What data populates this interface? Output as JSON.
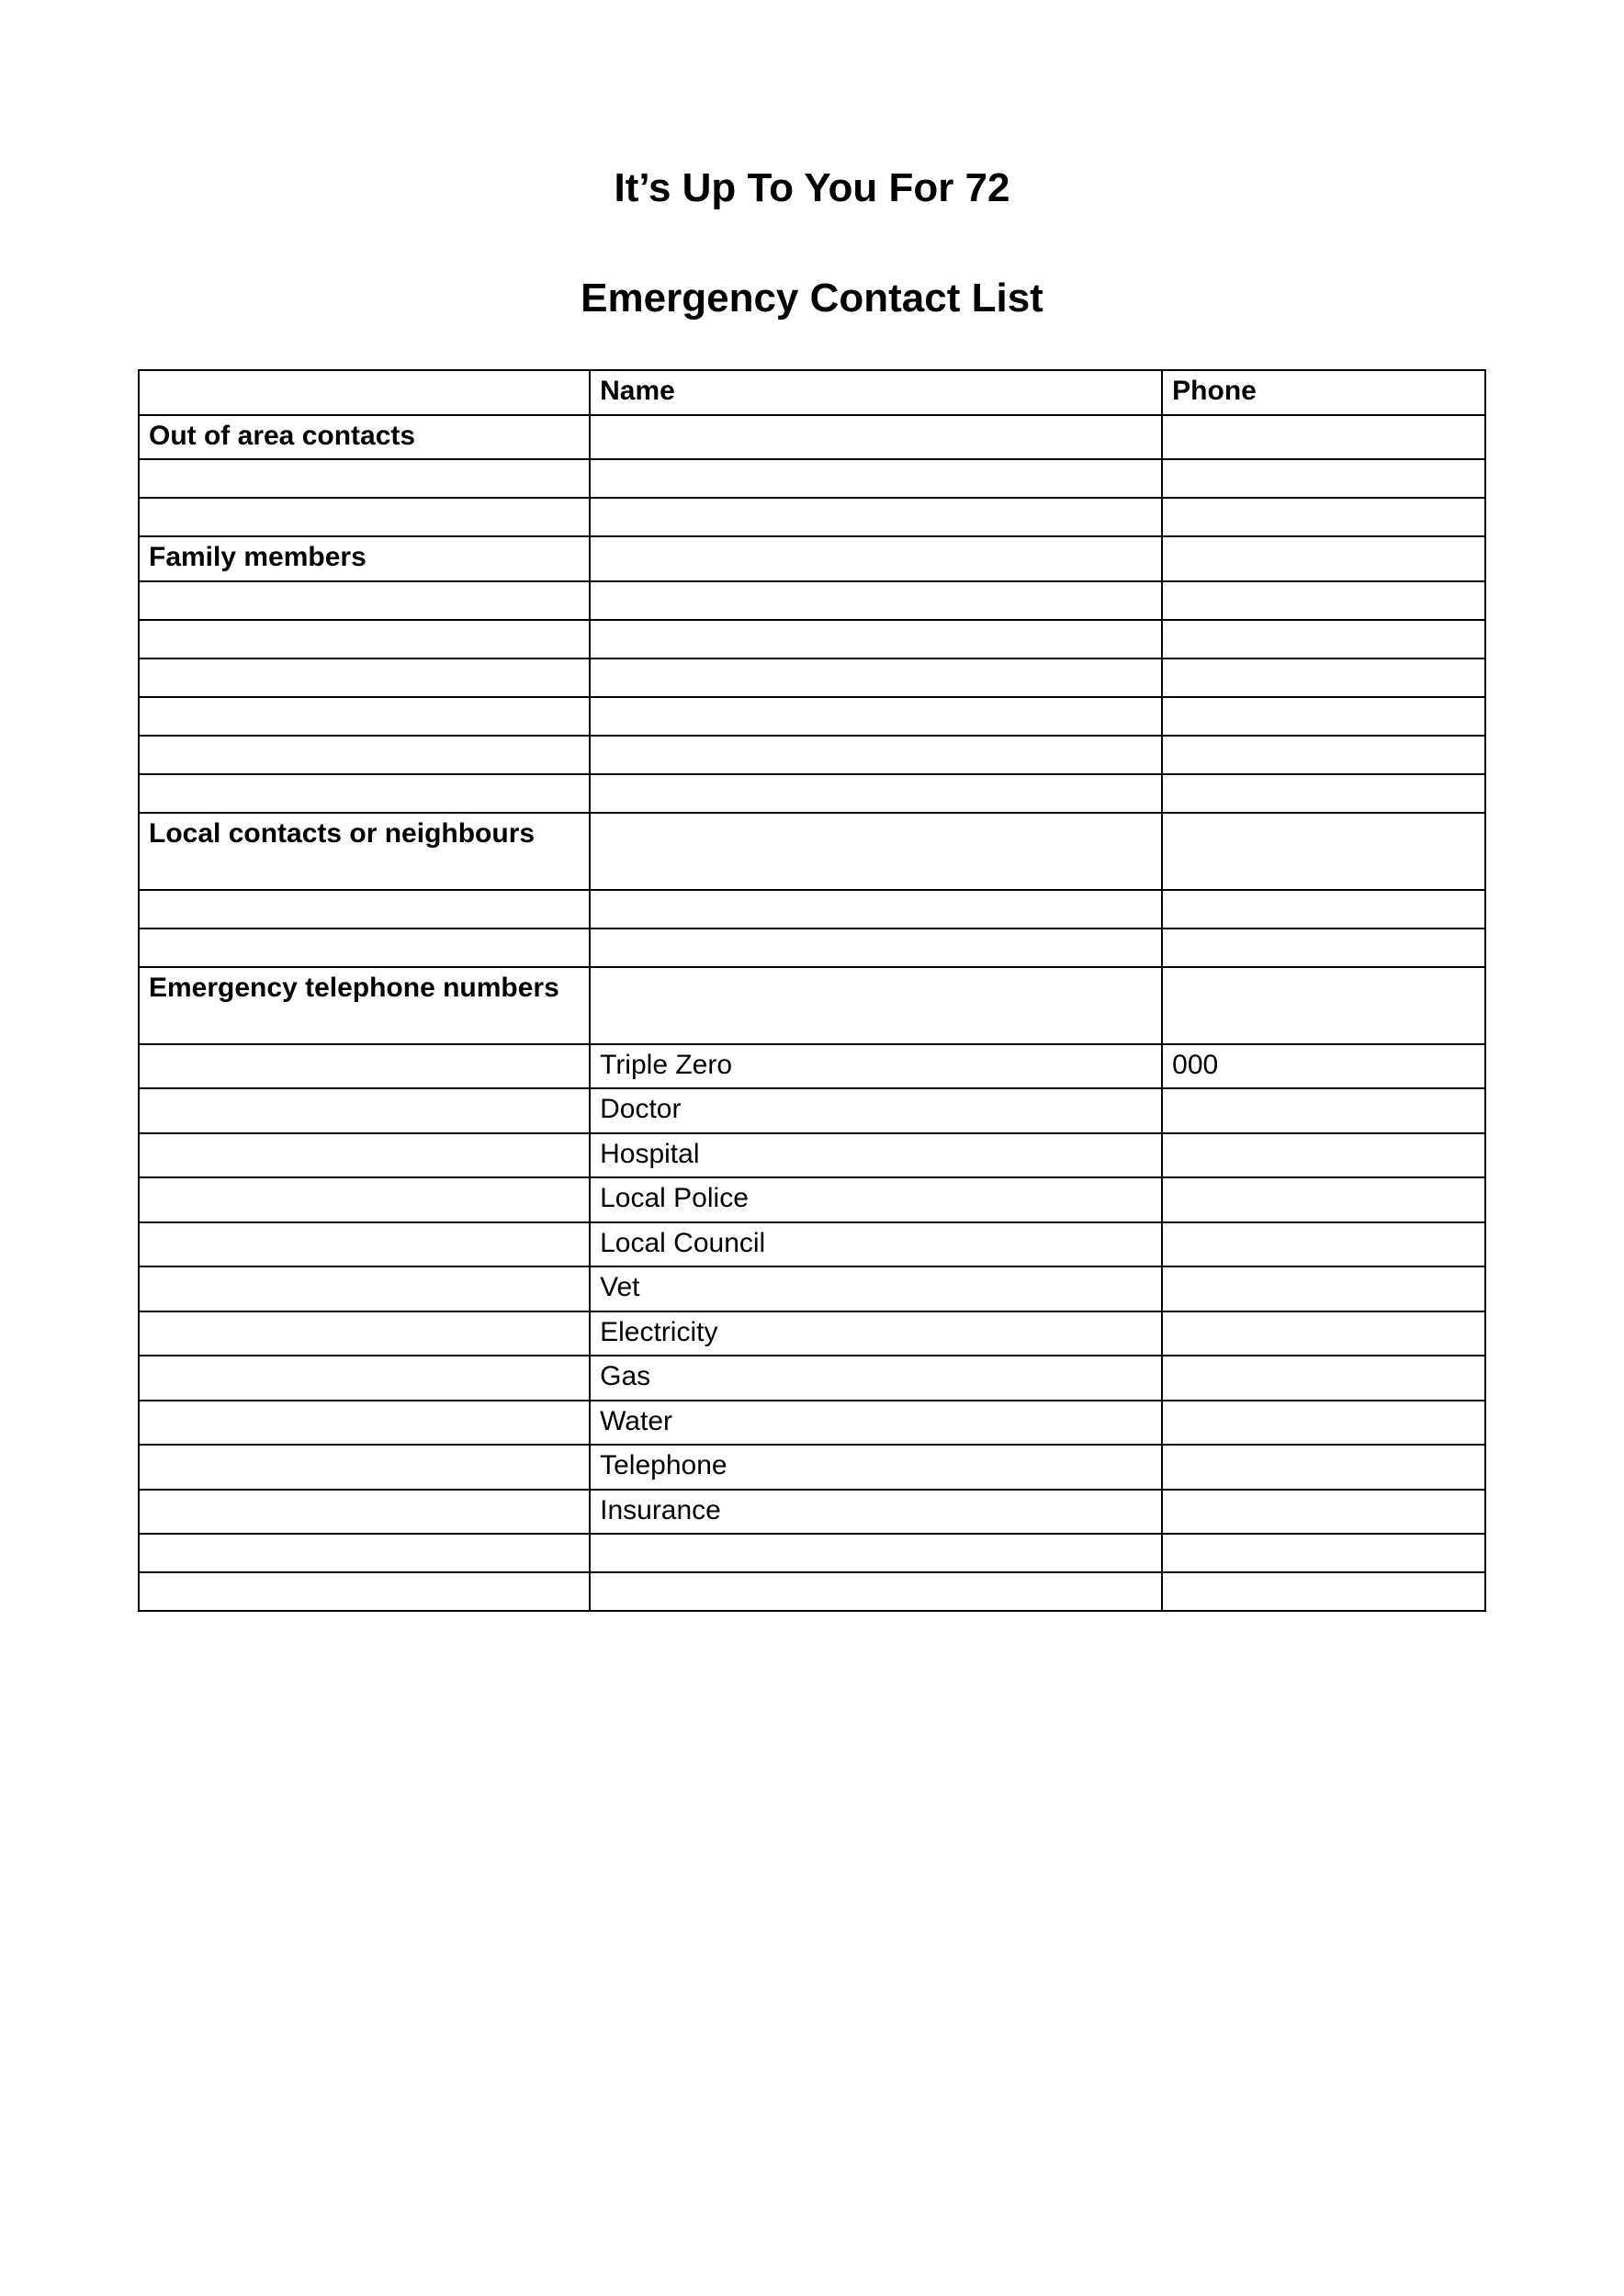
{
  "titles": {
    "line1": "It’s Up To You For 72",
    "line2": "Emergency Contact List"
  },
  "headers": {
    "col1": "",
    "col2": "Name",
    "col3": "Phone"
  },
  "sections": {
    "out_of_area": "Out of area contacts",
    "family": "Family members",
    "local": "Local contacts or neighbours",
    "emergency": "Emergency telephone numbers"
  },
  "emergency_rows": [
    {
      "label": "",
      "name": "Triple Zero",
      "phone": "000"
    },
    {
      "label": "",
      "name": "Doctor",
      "phone": ""
    },
    {
      "label": "",
      "name": "Hospital",
      "phone": ""
    },
    {
      "label": "",
      "name": "Local Police",
      "phone": ""
    },
    {
      "label": "",
      "name": "Local Council",
      "phone": ""
    },
    {
      "label": "",
      "name": "Vet",
      "phone": ""
    },
    {
      "label": "",
      "name": "Electricity",
      "phone": ""
    },
    {
      "label": "",
      "name": "Gas",
      "phone": ""
    },
    {
      "label": "",
      "name": "Water",
      "phone": ""
    },
    {
      "label": "",
      "name": "Telephone",
      "phone": ""
    },
    {
      "label": "",
      "name": "Insurance",
      "phone": ""
    }
  ],
  "blank_rows": {
    "after_out_of_area": 2,
    "after_family": 6,
    "after_local": 2,
    "after_emergency_list": 2
  }
}
